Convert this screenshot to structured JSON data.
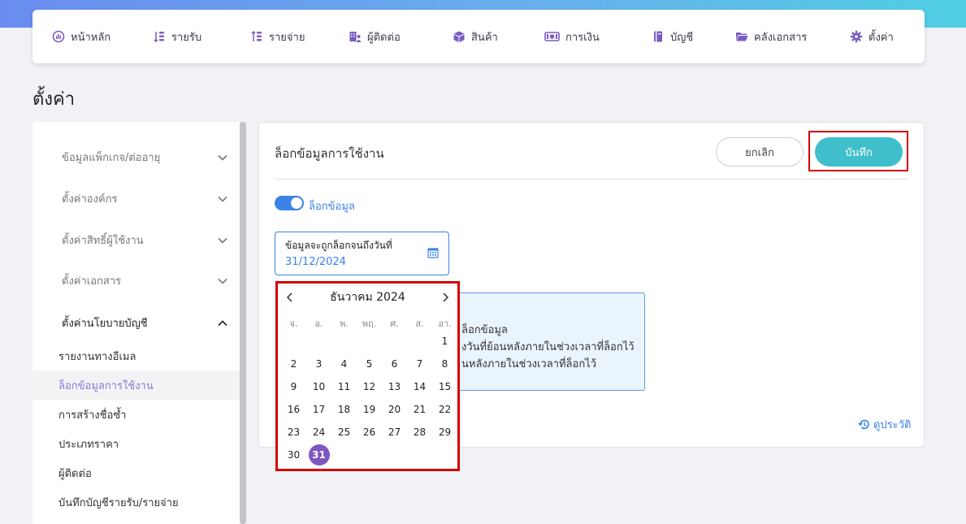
{
  "nav": {
    "items": [
      {
        "label": "หน้าหลัก",
        "icon": "dashboard-icon"
      },
      {
        "label": "รายรับ",
        "icon": "income-icon"
      },
      {
        "label": "รายจ่าย",
        "icon": "expense-icon"
      },
      {
        "label": "ผู้ติดต่อ",
        "icon": "contacts-icon"
      },
      {
        "label": "สินค้า",
        "icon": "box-icon"
      },
      {
        "label": "การเงิน",
        "icon": "money-icon"
      },
      {
        "label": "บัญชี",
        "icon": "ledger-icon"
      },
      {
        "label": "คลังเอกสาร",
        "icon": "folder-icon"
      },
      {
        "label": "ตั้งค่า",
        "icon": "gear-icon"
      }
    ]
  },
  "page": {
    "title": "ตั้งค่า"
  },
  "sidebar": {
    "sections": [
      {
        "label": "ข้อมูลแพ็กเกจ/ต่ออายุ",
        "expanded": false
      },
      {
        "label": "ตั้งค่าองค์กร",
        "expanded": false
      },
      {
        "label": "ตั้งค่าสิทธิ์ผู้ใช้งาน",
        "expanded": false
      },
      {
        "label": "ตั้งค่าเอกสาร",
        "expanded": false
      },
      {
        "label": "ตั้งค่านโยบายบัญชี",
        "expanded": true
      }
    ],
    "subitems": [
      {
        "label": "รายงานทางอีเมล",
        "active": false
      },
      {
        "label": "ล็อกข้อมูลการใช้งาน",
        "active": true
      },
      {
        "label": "การสร้างชื่อซ้ำ",
        "active": false
      },
      {
        "label": "ประเภทราคา",
        "active": false
      },
      {
        "label": "ผู้ติดต่อ",
        "active": false
      },
      {
        "label": "บันทึกบัญชีรายรับ/รายจ่าย",
        "active": false
      }
    ]
  },
  "card": {
    "title": "ล็อกข้อมูลการใช้งาน",
    "cancel_label": "ยกเลิก",
    "save_label": "บันทึก",
    "toggle_label": "ล็อกข้อมูล",
    "toggle_on": true,
    "date_field": {
      "label": "ข้อมูลจะถูกล็อกจนถึงวันที่",
      "value": "31/12/2024"
    },
    "info_lines": [
      "ล็อกข้อมูล",
      "งวันที่ย้อนหลังภายในช่วงเวลาที่ล็อกไว้",
      "นหลังภายในช่วงเวลาที่ล็อกไว้"
    ],
    "history_label": "ดูประวัติ"
  },
  "calendar": {
    "month_label": "ธันวาคม 2024",
    "weekdays": [
      "จ.",
      "อ.",
      "พ.",
      "พฤ.",
      "ศ.",
      "ส.",
      "อา."
    ],
    "weeks": [
      [
        "",
        "",
        "",
        "",
        "",
        "",
        "1"
      ],
      [
        "2",
        "3",
        "4",
        "5",
        "6",
        "7",
        "8"
      ],
      [
        "9",
        "10",
        "11",
        "12",
        "13",
        "14",
        "15"
      ],
      [
        "16",
        "17",
        "18",
        "19",
        "20",
        "21",
        "22"
      ],
      [
        "23",
        "24",
        "25",
        "26",
        "27",
        "28",
        "29"
      ],
      [
        "30",
        "31",
        "",
        "",
        "",
        "",
        ""
      ]
    ],
    "selected_day": "31"
  },
  "colors": {
    "accent_blue": "#3b82e6",
    "save_button": "#3fbfcb",
    "selected_day": "#7e57c2",
    "highlight_box": "#d40000",
    "active_sidebar_text": "#8a7bd0"
  }
}
